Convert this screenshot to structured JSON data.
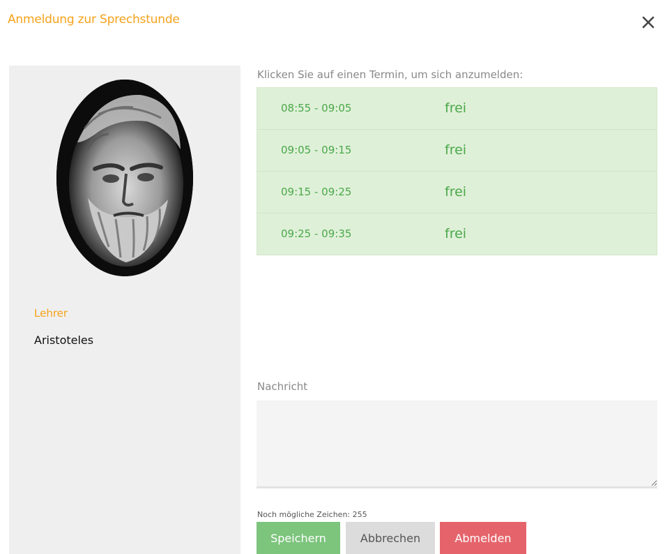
{
  "dialog": {
    "title": "Anmeldung zur Sprechstunde",
    "close_icon": "close-icon"
  },
  "teacher": {
    "role_label": "Lehrer",
    "name": "Aristoteles"
  },
  "appointments": {
    "instruction": "Klicken Sie auf einen Termin, um sich anzumelden:",
    "slots": [
      {
        "time": "08:55 - 09:05",
        "status": "frei"
      },
      {
        "time": "09:05 - 09:15",
        "status": "frei"
      },
      {
        "time": "09:15 - 09:25",
        "status": "frei"
      },
      {
        "time": "09:25 - 09:35",
        "status": "frei"
      }
    ]
  },
  "message": {
    "label": "Nachricht",
    "value": "",
    "counter": "Noch mögliche Zeichen: 255"
  },
  "buttons": {
    "save": "Speichern",
    "cancel": "Abbrechen",
    "unregister": "Abmelden"
  },
  "colors": {
    "accent": "#f5a21a",
    "slot_background": "#dff0d8",
    "slot_text": "#4aa84a",
    "save": "#7dc47d",
    "cancel": "#dcdcdc",
    "unregister": "#e5646b"
  }
}
